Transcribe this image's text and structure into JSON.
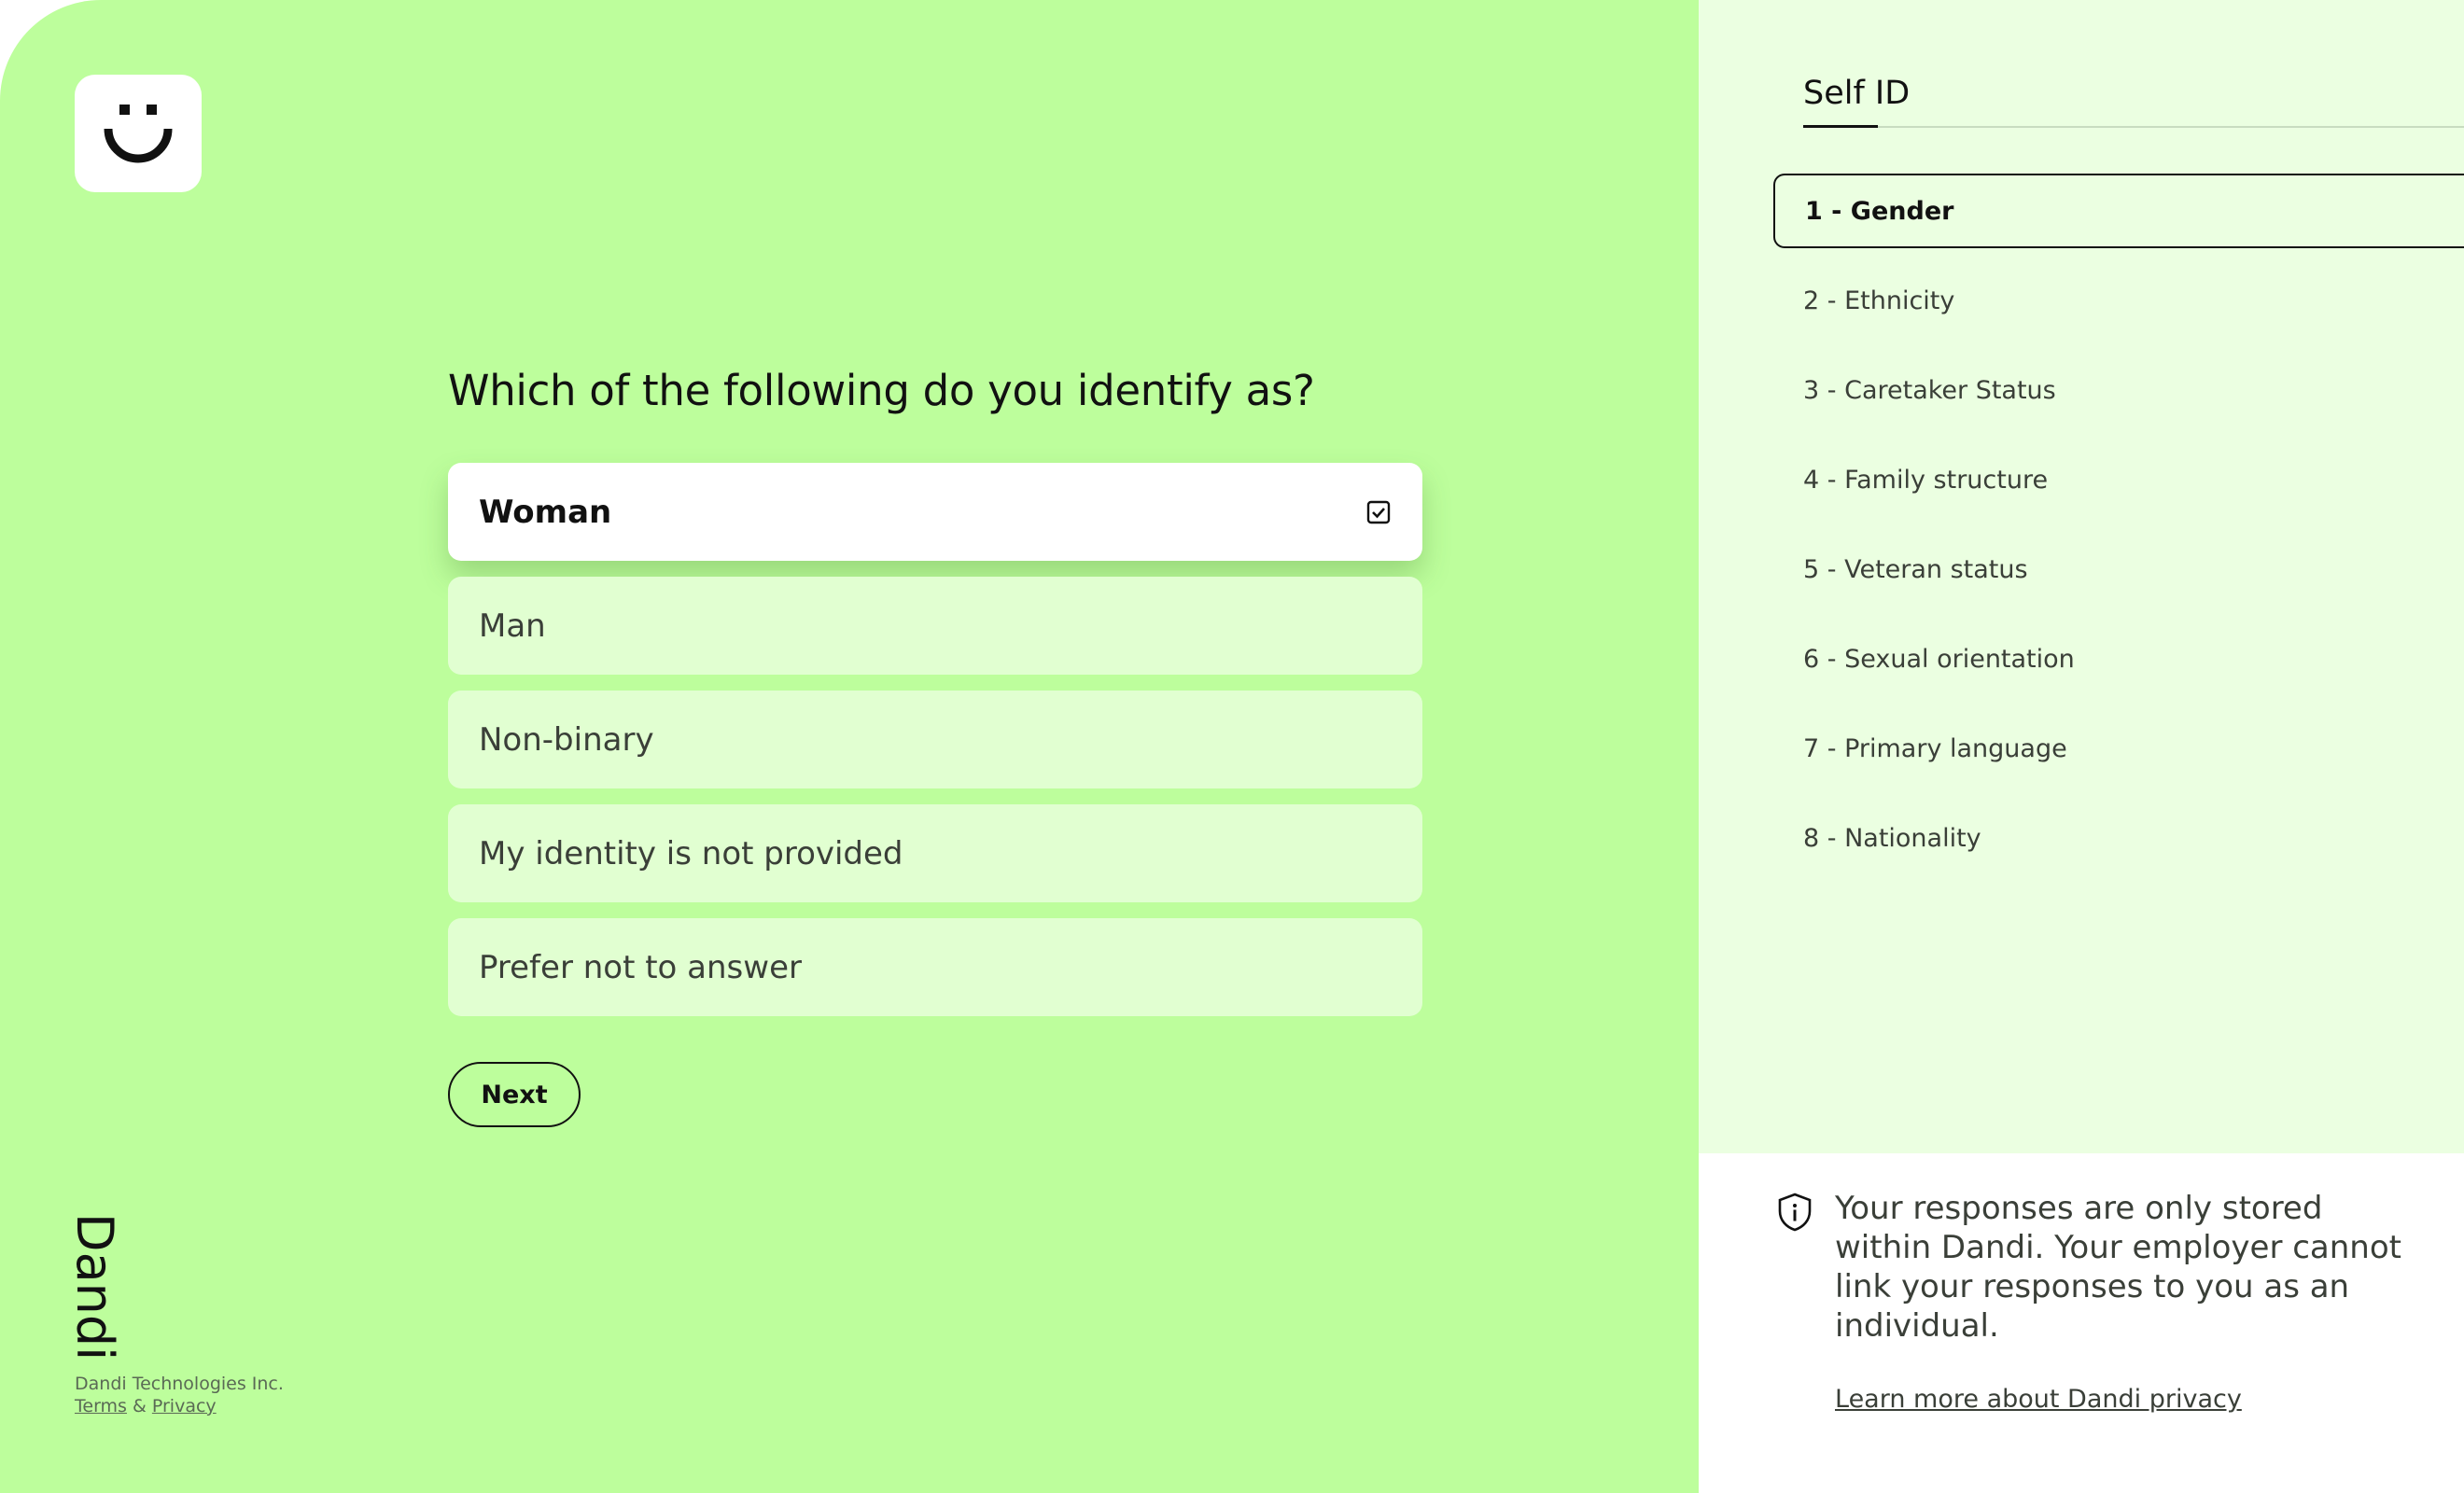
{
  "brand": {
    "name": "Dandi",
    "company": "Dandi Technologies Inc.",
    "terms_label": "Terms",
    "amp": "&",
    "privacy_label": "Privacy"
  },
  "question": {
    "text": "Which of the following do you identify as?",
    "options": [
      {
        "label": "Woman",
        "selected": true
      },
      {
        "label": "Man",
        "selected": false
      },
      {
        "label": "Non-binary",
        "selected": false
      },
      {
        "label": "My identity is not provided",
        "selected": false
      },
      {
        "label": "Prefer not to answer",
        "selected": false
      }
    ],
    "next_label": "Next"
  },
  "sidebar": {
    "title": "Self ID",
    "steps": [
      {
        "label": "1 - Gender",
        "active": true
      },
      {
        "label": "2 - Ethnicity",
        "active": false
      },
      {
        "label": "3 - Caretaker Status",
        "active": false
      },
      {
        "label": "4 - Family structure",
        "active": false
      },
      {
        "label": "5 - Veteran status",
        "active": false
      },
      {
        "label": "6 - Sexual orientation",
        "active": false
      },
      {
        "label": "7 - Primary language",
        "active": false
      },
      {
        "label": "8 - Nationality",
        "active": false
      }
    ]
  },
  "privacy": {
    "icon": "shield-info-icon",
    "text": "Your responses are only stored within Dandi. Your employer cannot link your responses to you as an individual.",
    "link_label": "Learn more about Dandi privacy"
  },
  "colors": {
    "primary_bg": "#bdfe9c",
    "option_bg": "#e1ffd1",
    "sidebar_bg": "#ebffe1",
    "text": "#111111"
  }
}
